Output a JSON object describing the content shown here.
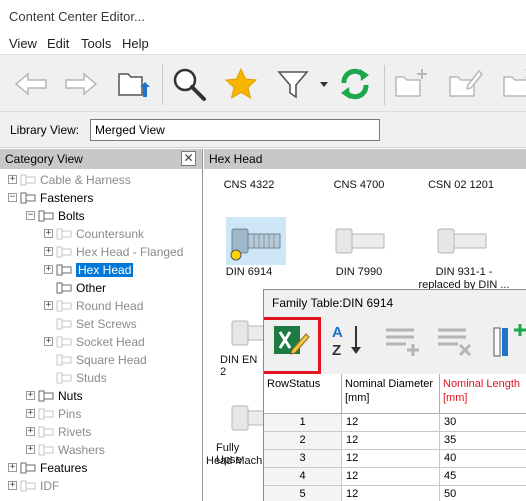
{
  "window": {
    "title": "Content Center Editor..."
  },
  "menu": [
    "View",
    "Edit",
    "Tools",
    "Help"
  ],
  "library": {
    "label": "Library View:",
    "value": "Merged View"
  },
  "category_view": {
    "title": "Category View",
    "close": "✕",
    "items": [
      {
        "label": "Cable & Harness",
        "level": 0,
        "expander": "+",
        "grey": true
      },
      {
        "label": "Fasteners",
        "level": 0,
        "expander": "−",
        "grey": false
      },
      {
        "label": "Bolts",
        "level": 1,
        "expander": "−",
        "grey": false
      },
      {
        "label": "Countersunk",
        "level": 2,
        "expander": "+",
        "grey": true
      },
      {
        "label": "Hex Head - Flanged",
        "level": 2,
        "expander": "+",
        "grey": true
      },
      {
        "label": "Hex Head",
        "level": 2,
        "expander": "+",
        "grey": false,
        "selected": true
      },
      {
        "label": "Other",
        "level": 2,
        "expander": "",
        "grey": false
      },
      {
        "label": "Round Head",
        "level": 2,
        "expander": "+",
        "grey": true
      },
      {
        "label": "Set Screws",
        "level": 2,
        "expander": "",
        "grey": true
      },
      {
        "label": "Socket Head",
        "level": 2,
        "expander": "+",
        "grey": true
      },
      {
        "label": "Square Head",
        "level": 2,
        "expander": "",
        "grey": true
      },
      {
        "label": "Studs",
        "level": 2,
        "expander": "",
        "grey": true
      },
      {
        "label": "Nuts",
        "level": 1,
        "expander": "+",
        "grey": false
      },
      {
        "label": "Pins",
        "level": 1,
        "expander": "+",
        "grey": true
      },
      {
        "label": "Rivets",
        "level": 1,
        "expander": "+",
        "grey": true
      },
      {
        "label": "Washers",
        "level": 1,
        "expander": "+",
        "grey": true
      },
      {
        "label": "Features",
        "level": 0,
        "expander": "+",
        "grey": false
      },
      {
        "label": "IDF",
        "level": 0,
        "expander": "+",
        "grey": true
      }
    ]
  },
  "hex_view": {
    "title": "Hex Head",
    "row1": [
      "CNS 4322",
      "CNS 4700",
      "CSN 02 1201"
    ],
    "row2": [
      "DIN 6914",
      "DIN 7990",
      "DIN 931-1 - replaced by DIN ..."
    ],
    "row3_partial": "DIN EN 2",
    "row4_partial_line1": "Fully Upse",
    "row4_partial_line2": "Head Machi"
  },
  "family_table": {
    "title": "Family Table:DIN 6914",
    "columns": [
      {
        "label": "RowStatus",
        "highlight": false
      },
      {
        "label": "Nominal Diameter [mm]",
        "highlight": false
      },
      {
        "label": "Nominal Length [mm]",
        "highlight": true
      }
    ],
    "rows": [
      {
        "status": "1",
        "diameter": "12",
        "length": "30"
      },
      {
        "status": "2",
        "diameter": "12",
        "length": "35"
      },
      {
        "status": "3",
        "diameter": "12",
        "length": "40"
      },
      {
        "status": "4",
        "diameter": "12",
        "length": "45"
      },
      {
        "status": "5",
        "diameter": "12",
        "length": "50"
      }
    ]
  },
  "colors": {
    "selection": "#0078d7",
    "highlight_red": "#e3141f",
    "refresh_green": "#1aa84b",
    "star": "#f7b500"
  }
}
